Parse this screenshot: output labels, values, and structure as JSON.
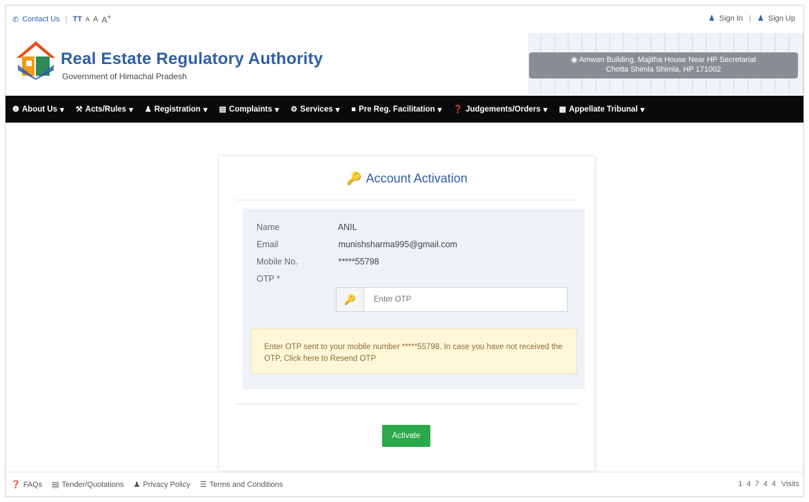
{
  "topbar": {
    "contact": "Contact Us",
    "font_sizes": [
      "A",
      "A",
      "A"
    ],
    "font_size_label": "TT",
    "sign_in": "Sign In",
    "sign_up": "Sign Up"
  },
  "header": {
    "title": "Real Estate Regulatory Authority",
    "subtitle": "Government of Himachal Pradesh",
    "address_line1": "Amwan Building, Majitha House Near HP Secretariat",
    "address_line2": "Chotta Shimla Shimla, HP 171002"
  },
  "nav": [
    {
      "label": "About Us",
      "icon": "info-icon"
    },
    {
      "label": "Acts/Rules",
      "icon": "gavel-icon"
    },
    {
      "label": "Registration",
      "icon": "user-icon"
    },
    {
      "label": "Complaints",
      "icon": "clipboard-icon"
    },
    {
      "label": "Services",
      "icon": "cogs-icon"
    },
    {
      "label": "Pre Reg. Facilitation",
      "icon": "folder-icon"
    },
    {
      "label": "Judgements/Orders",
      "icon": "question-icon"
    },
    {
      "label": "Appellate Tribunal",
      "icon": "book-icon"
    }
  ],
  "card": {
    "title": "Account Activation",
    "fields": {
      "name_label": "Name",
      "name_value": "ANIL",
      "email_label": "Email",
      "email_value": "munishsharma995@gmail.com",
      "mobile_label": "Mobile No.",
      "mobile_value": "*****55798",
      "otp_label": "OTP *",
      "otp_placeholder": "Enter OTP"
    },
    "alert": "Enter OTP sent to your mobile number *****55798. In case you have not received the OTP, Click here to Resend OTP",
    "activate_label": "Activate"
  },
  "footer": {
    "links": [
      {
        "label": "FAQs",
        "icon": "question-icon"
      },
      {
        "label": "Tender/Quotations",
        "icon": "newspaper-icon"
      },
      {
        "label": "Privacy Policy",
        "icon": "user-icon"
      },
      {
        "label": "Terms and Conditions",
        "icon": "list-icon"
      }
    ],
    "counter_digits": [
      "1",
      "4",
      "7",
      "4",
      "4"
    ],
    "visits_label": "Visits"
  },
  "colors": {
    "brand": "#2f5fa8",
    "nav_bg": "#0a0a0a",
    "success": "#2ba84a",
    "alert_bg": "#fff7d6"
  }
}
